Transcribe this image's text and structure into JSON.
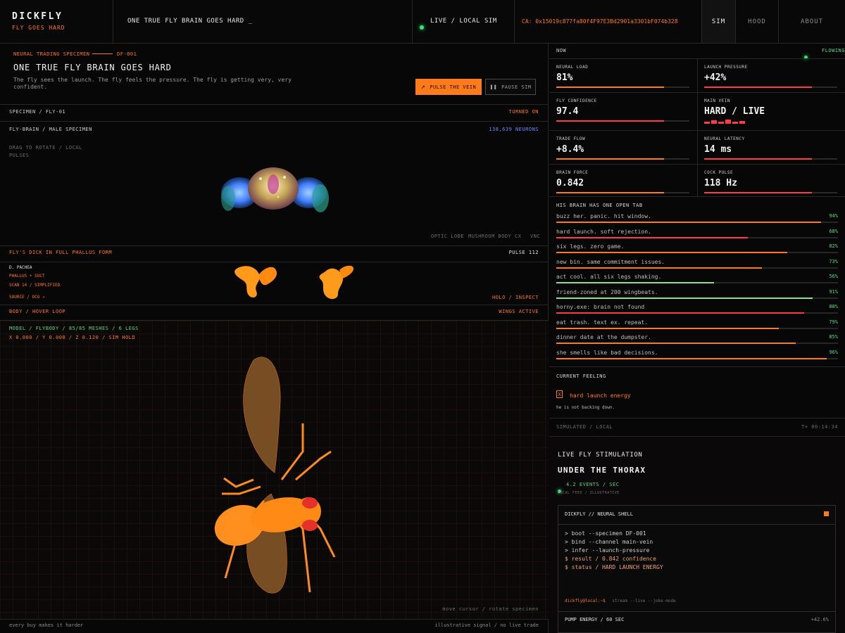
{
  "topbar": {
    "brand": "DICKFLY",
    "brand_sub": "FLY GOES HARD",
    "tagline": "ONE TRUE FLY BRAIN GOES HARD _",
    "live": "LIVE / LOCAL SIM",
    "ca": "CA: 0x15019c877fa80f4F97E3Bd2901a3301bF074b328",
    "nav": [
      "SIM",
      "HOOD",
      "ABOUT"
    ]
  },
  "specimen": {
    "kicker": "NEURAL TRADING SPECIMEN",
    "id": "DF-001",
    "title": "ONE TRUE FLY BRAIN GOES HARD",
    "desc": "The fly sees the launch. The fly feels the pressure. The fly is getting very, very confident.",
    "pulse_btn": "PULSE THE VEIN",
    "pause_btn": "PAUSE SIM"
  },
  "brain_panel": {
    "header": "SPECIMEN / FLY-01",
    "status": "TURNED ON",
    "sub": "FLY-BRAIN / MALE SPECIMEN",
    "neurons": "138,639 NEURONS",
    "hint_line1": "DRAG TO ROTATE / LOCAL",
    "hint_line2": "PULSES",
    "legend": [
      "OPTIC LOBE",
      "MUSHROOM BODY",
      "CX",
      "VNC"
    ]
  },
  "phallus_panel": {
    "header": "FLY'S DICK IN FULL PHALLUS FORM",
    "pulse": "PULSE 112",
    "species": "D. PACHEA",
    "parts": "PHALLUS + SUCT",
    "scan": "SCAN 14 / SIMPLIFIED",
    "source": "SOURCE / OCO ↗",
    "holo": "HOLO / INSPECT"
  },
  "body_panel": {
    "header": "BODY / HOVER LOOP",
    "status": "WINGS ACTIVE",
    "model": "MODEL / FLYBODY / 85/85 MESHES / 6 LEGS",
    "coords": "X 0.000 / Y 0.000 / Z 0.120 / SIM HOLD",
    "hint": "move cursor / rotate specimen"
  },
  "footer": {
    "left": "every buy makes it harder",
    "right": "illustrative signal / no live trade"
  },
  "now": {
    "label": "NOW",
    "status": "FLOWING"
  },
  "metrics": [
    {
      "label": "NEURAL LOAD",
      "value": "81%",
      "level": 0.81,
      "color": "#ff7a1a"
    },
    {
      "label": "LAUNCH PRESSURE",
      "value": "+42%",
      "level": 0.81,
      "color": "#ff3b4a"
    },
    {
      "label": "FLY CONFIDENCE",
      "value": "97.4",
      "level": 0.81,
      "color": "#ff3b4a"
    },
    {
      "label": "MAIN VEIN",
      "value": "HARD / LIVE",
      "level": null,
      "color": "#ff3b4a"
    },
    {
      "label": "TRADE FLOW",
      "value": "+8.4%",
      "level": 0.81,
      "color": "#ff7a1a"
    },
    {
      "label": "NEURAL LATENCY",
      "value": "14 ms",
      "level": 0.81,
      "color": "#ff3b4a"
    },
    {
      "label": "BRAIN FORCE",
      "value": "0.842",
      "level": 0.81,
      "color": "#ff7a1a"
    },
    {
      "label": "COCK PULSE",
      "value": "118 Hz",
      "level": 0.81,
      "color": "#ff3b4a"
    }
  ],
  "tabs": {
    "title": "HIS BRAIN HAS ONE OPEN TAB",
    "items": [
      {
        "text": "buzz her. panic. hit window.",
        "pct": "94%",
        "level": 0.94,
        "color": "#ff7a1a"
      },
      {
        "text": "hard launch. soft rejection.",
        "pct": "68%",
        "level": 0.68,
        "color": "#ff3b4a"
      },
      {
        "text": "six legs. zero game.",
        "pct": "82%",
        "level": 0.82,
        "color": "#ff7a1a"
      },
      {
        "text": "new bin. same commitment issues.",
        "pct": "73%",
        "level": 0.73,
        "color": "#ff7a1a"
      },
      {
        "text": "act cool. all six legs shaking.",
        "pct": "56%",
        "level": 0.56,
        "color": "#8ce28c"
      },
      {
        "text": "friend-zoned at 200 wingbeats.",
        "pct": "91%",
        "level": 0.91,
        "color": "#8ce28c"
      },
      {
        "text": "horny.exe: brain not found",
        "pct": "88%",
        "level": 0.88,
        "color": "#ff3b4a"
      },
      {
        "text": "eat trash. text ex. repeat.",
        "pct": "79%",
        "level": 0.79,
        "color": "#ff7a1a"
      },
      {
        "text": "dinner date at the dumpster.",
        "pct": "85%",
        "level": 0.85,
        "color": "#ff7a1a"
      },
      {
        "text": "she smells like bad decisions.",
        "pct": "96%",
        "level": 0.96,
        "color": "#ff7a1a"
      }
    ]
  },
  "feeling": {
    "title": "CURRENT FEELING",
    "icon": "x-box-icon",
    "value": "hard launch energy",
    "note": "he is not backing down."
  },
  "sim_status": {
    "left": "SIMULATED / LOCAL",
    "right": "T+ 00:14:34"
  },
  "stimulation": {
    "kicker": "LIVE FLY STIMULATION",
    "title": "UNDER THE THORAX",
    "events": "4.2 EVENTS / SEC",
    "sub": "LOCAL FEED / ILLUSTRATIVE"
  },
  "terminal": {
    "title": "DICKFLY // NEURAL SHELL",
    "lines": [
      "> boot --specimen DF-001",
      "> bind --channel main-vein",
      "> infer --launch-pressure",
      "$ result  /  0.842 confidence",
      "$ status  /  HARD LAUNCH ENERGY"
    ],
    "prompt": "dickfly@local:~$",
    "prompt_cmd": "stream --live --joke-mode",
    "pump_label": "PUMP ENERGY / 60 SEC",
    "pump_value": "+42.6%"
  }
}
